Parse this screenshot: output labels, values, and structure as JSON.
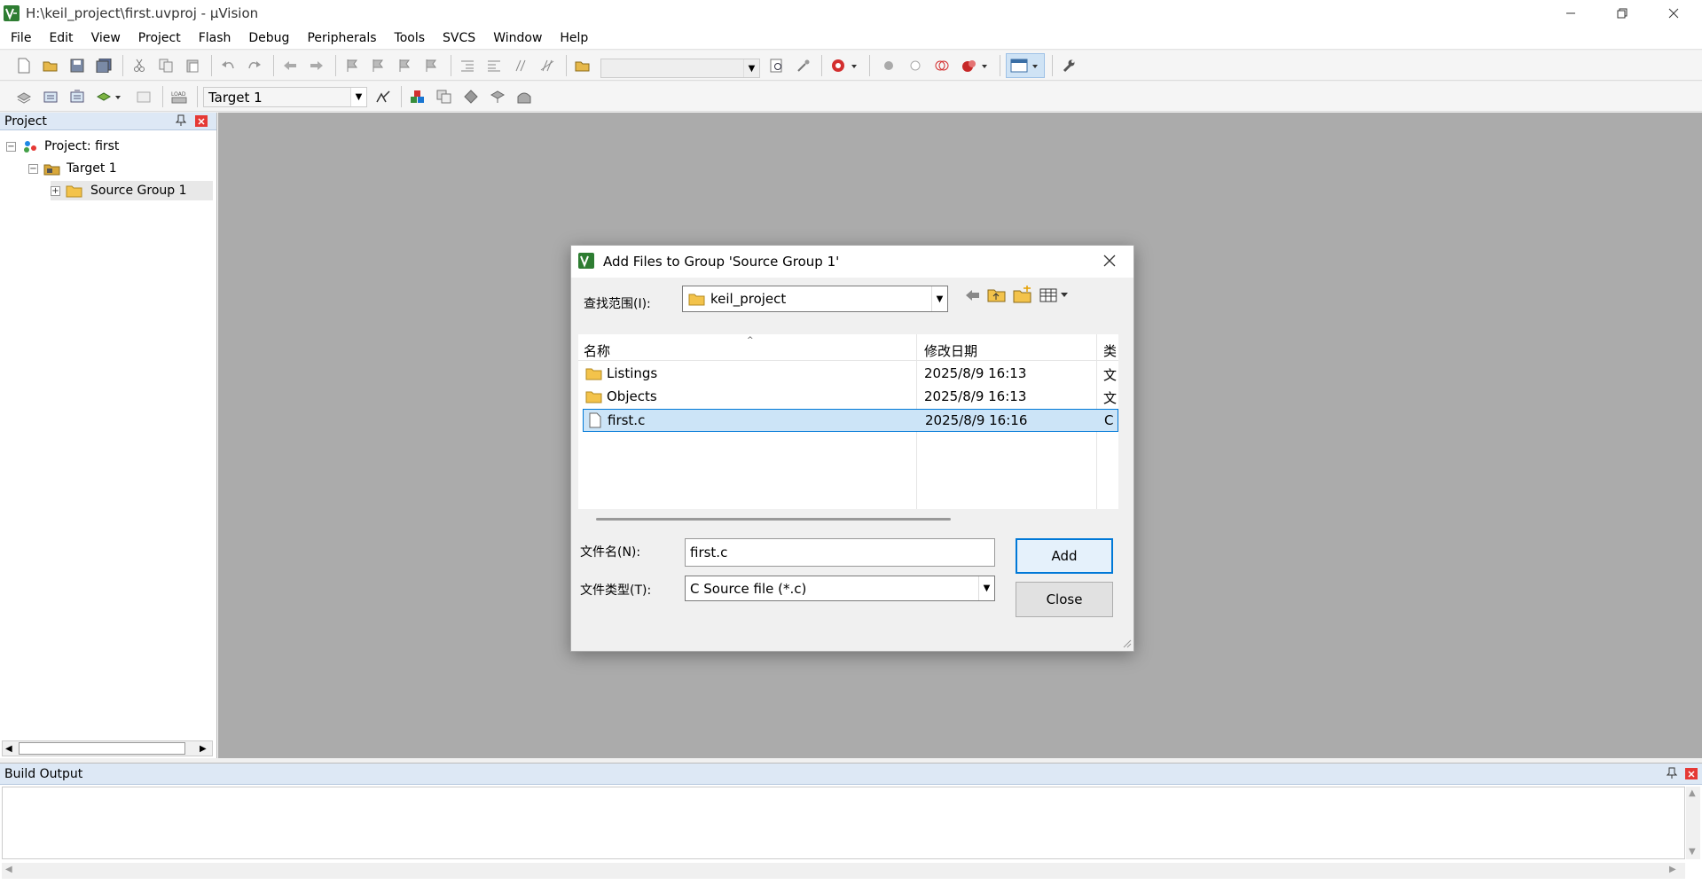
{
  "window": {
    "title": "H:\\keil_project\\first.uvproj - µVision"
  },
  "menu": [
    "File",
    "Edit",
    "View",
    "Project",
    "Flash",
    "Debug",
    "Peripherals",
    "Tools",
    "SVCS",
    "Window",
    "Help"
  ],
  "toolbar2": {
    "target": "Target 1"
  },
  "project_panel": {
    "title": "Project",
    "tree": {
      "project": "Project: first",
      "target": "Target 1",
      "group": "Source Group 1"
    }
  },
  "build_output": {
    "title": "Build Output"
  },
  "dialog": {
    "title": "Add Files to Group 'Source Group 1'",
    "look_in_label": "查找范围(I):",
    "look_in_value": "keil_project",
    "columns": {
      "name": "名称",
      "modified": "修改日期",
      "type": "类"
    },
    "files": [
      {
        "name": "Listings",
        "date": "2025/8/9 16:13",
        "type": "文",
        "kind": "folder"
      },
      {
        "name": "Objects",
        "date": "2025/8/9 16:13",
        "type": "文",
        "kind": "folder"
      },
      {
        "name": "first.c",
        "date": "2025/8/9 16:16",
        "type": "C",
        "kind": "file",
        "selected": true
      }
    ],
    "filename_label": "文件名(N):",
    "filename_value": "first.c",
    "filetype_label": "文件类型(T):",
    "filetype_value": "C Source file (*.c)",
    "add_button": "Add",
    "close_button": "Close"
  },
  "colors": {
    "accent": "#cce4f7",
    "selected_border": "#0078d7",
    "workspace": "#ababab",
    "panel_header": "#dde8f5"
  }
}
